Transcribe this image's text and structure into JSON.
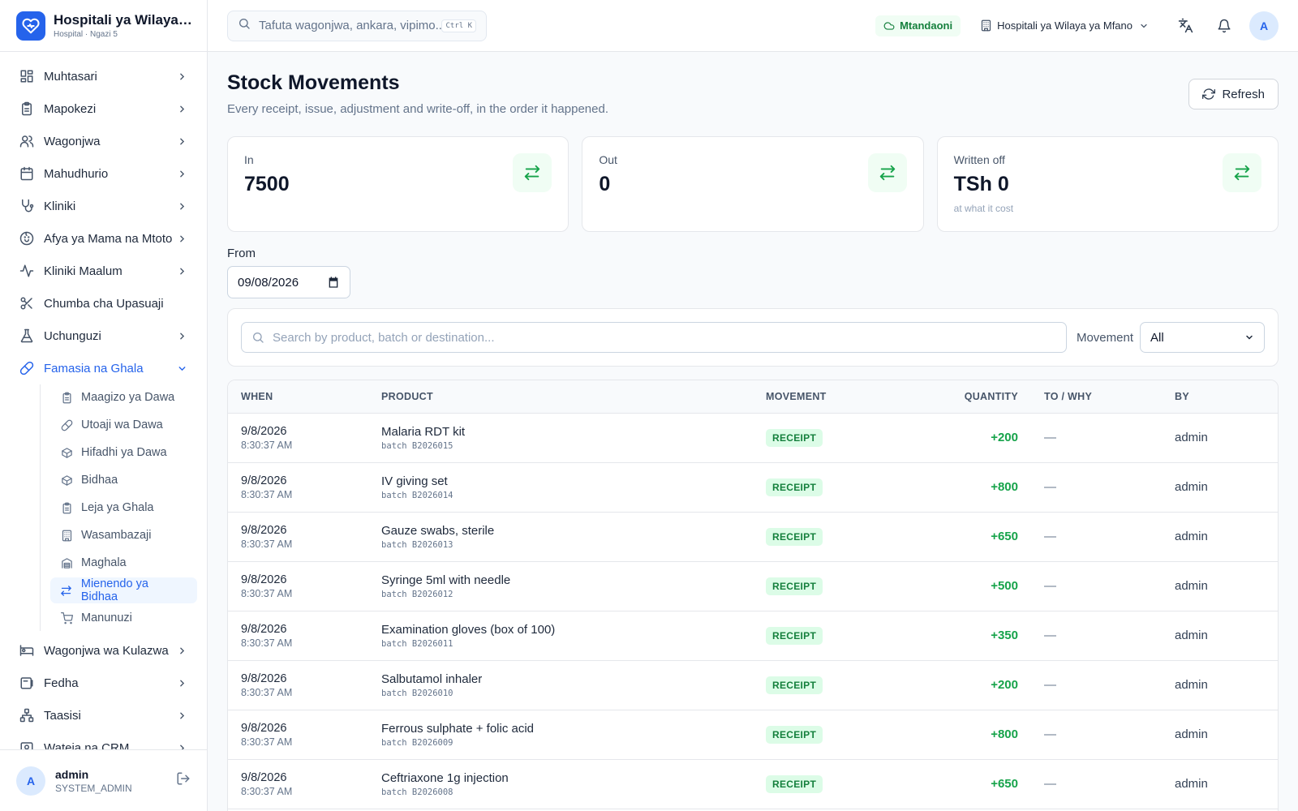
{
  "brand": {
    "name": "Hospitali ya Wilaya ya Mfano",
    "sub": "Hospital · Ngazi 5"
  },
  "sidebar": {
    "items": [
      {
        "label": "Muhtasari",
        "icon": "grid-icon",
        "chevron": true
      },
      {
        "label": "Mapokezi",
        "icon": "clipboard-icon",
        "chevron": true
      },
      {
        "label": "Wagonjwa",
        "icon": "users-icon",
        "chevron": true
      },
      {
        "label": "Mahudhurio",
        "icon": "calendar-icon",
        "chevron": true
      },
      {
        "label": "Kliniki",
        "icon": "stethoscope-icon",
        "chevron": true
      },
      {
        "label": "Afya ya Mama na Mtoto",
        "icon": "baby-icon",
        "chevron": true
      },
      {
        "label": "Kliniki Maalum",
        "icon": "activity-icon",
        "chevron": true
      },
      {
        "label": "Chumba cha Upasuaji",
        "icon": "scissors-icon",
        "chevron": false
      },
      {
        "label": "Uchunguzi",
        "icon": "flask-icon",
        "chevron": true
      },
      {
        "label": "Famasia na Ghala",
        "icon": "pill-icon",
        "chevron": true,
        "open": true
      }
    ],
    "subitems": [
      {
        "label": "Maagizo ya Dawa",
        "icon": "clipboard-icon"
      },
      {
        "label": "Utoaji wa Dawa",
        "icon": "pill-icon"
      },
      {
        "label": "Hifadhi ya Dawa",
        "icon": "box-icon"
      },
      {
        "label": "Bidhaa",
        "icon": "box-icon"
      },
      {
        "label": "Leja ya Ghala",
        "icon": "clipboard-icon"
      },
      {
        "label": "Wasambazaji",
        "icon": "building-icon"
      },
      {
        "label": "Maghala",
        "icon": "warehouse-icon"
      },
      {
        "label": "Mienendo ya Bidhaa",
        "icon": "arrows-icon",
        "active": true
      },
      {
        "label": "Manunuzi",
        "icon": "cart-icon"
      }
    ],
    "items_after": [
      {
        "label": "Wagonjwa wa Kulazwa",
        "icon": "bed-icon",
        "chevron": true
      },
      {
        "label": "Fedha",
        "icon": "wallet-icon",
        "chevron": true
      },
      {
        "label": "Taasisi",
        "icon": "network-icon",
        "chevron": true
      },
      {
        "label": "Wateja na CRM",
        "icon": "contacts-icon",
        "chevron": true
      }
    ]
  },
  "user": {
    "initial": "A",
    "name": "admin",
    "role": "SYSTEM_ADMIN"
  },
  "topbar": {
    "search_placeholder": "Tafuta wagonjwa, ankara, vipimo...",
    "shortcut": "Ctrl K",
    "status": "Mtandaoni",
    "facility": "Hospitali ya Wilaya ya Mfano",
    "avatar": "A"
  },
  "page": {
    "title": "Stock Movements",
    "subtitle": "Every receipt, issue, adjustment and write-off, in the order it happened.",
    "refresh": "Refresh"
  },
  "stats": [
    {
      "label": "In",
      "value": "7500",
      "note": ""
    },
    {
      "label": "Out",
      "value": "0",
      "note": ""
    },
    {
      "label": "Written off",
      "value": "TSh 0",
      "note": "at what it cost"
    }
  ],
  "filters": {
    "from_label": "From",
    "from_value": "09/08/2026",
    "search_placeholder": "Search by product, batch or destination...",
    "movement_label": "Movement",
    "movement_value": "All"
  },
  "table": {
    "headers": [
      "WHEN",
      "PRODUCT",
      "MOVEMENT",
      "QUANTITY",
      "TO / WHY",
      "BY"
    ],
    "rows": [
      {
        "date": "9/8/2026",
        "time": "8:30:37 AM",
        "product": "Malaria RDT kit",
        "batch": "batch B2026015",
        "movement": "RECEIPT",
        "qty": "+200",
        "to": "—",
        "by": "admin"
      },
      {
        "date": "9/8/2026",
        "time": "8:30:37 AM",
        "product": "IV giving set",
        "batch": "batch B2026014",
        "movement": "RECEIPT",
        "qty": "+800",
        "to": "—",
        "by": "admin"
      },
      {
        "date": "9/8/2026",
        "time": "8:30:37 AM",
        "product": "Gauze swabs, sterile",
        "batch": "batch B2026013",
        "movement": "RECEIPT",
        "qty": "+650",
        "to": "—",
        "by": "admin"
      },
      {
        "date": "9/8/2026",
        "time": "8:30:37 AM",
        "product": "Syringe 5ml with needle",
        "batch": "batch B2026012",
        "movement": "RECEIPT",
        "qty": "+500",
        "to": "—",
        "by": "admin"
      },
      {
        "date": "9/8/2026",
        "time": "8:30:37 AM",
        "product": "Examination gloves (box of 100)",
        "batch": "batch B2026011",
        "movement": "RECEIPT",
        "qty": "+350",
        "to": "—",
        "by": "admin"
      },
      {
        "date": "9/8/2026",
        "time": "8:30:37 AM",
        "product": "Salbutamol inhaler",
        "batch": "batch B2026010",
        "movement": "RECEIPT",
        "qty": "+200",
        "to": "—",
        "by": "admin"
      },
      {
        "date": "9/8/2026",
        "time": "8:30:37 AM",
        "product": "Ferrous sulphate + folic acid",
        "batch": "batch B2026009",
        "movement": "RECEIPT",
        "qty": "+800",
        "to": "—",
        "by": "admin"
      },
      {
        "date": "9/8/2026",
        "time": "8:30:37 AM",
        "product": "Ceftriaxone 1g injection",
        "batch": "batch B2026008",
        "movement": "RECEIPT",
        "qty": "+650",
        "to": "—",
        "by": "admin"
      }
    ]
  },
  "colors": {
    "accent": "#2563eb",
    "success": "#16a34a",
    "success_bg": "#dcfce7"
  }
}
